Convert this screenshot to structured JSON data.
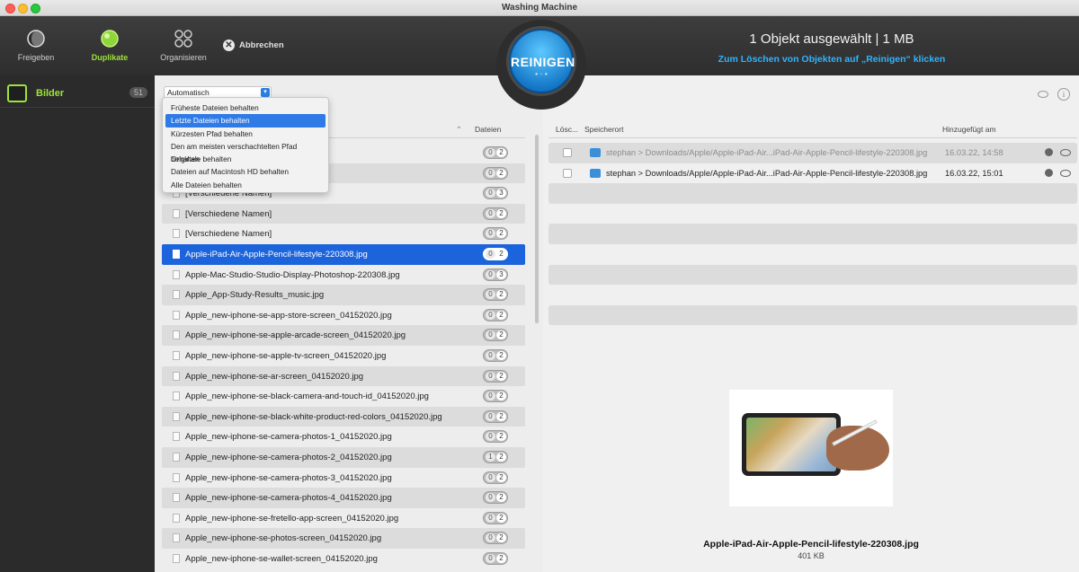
{
  "window": {
    "title": "Washing Machine"
  },
  "toolbar": {
    "tools": [
      {
        "label": "Freigeben",
        "icon": "moon-icon"
      },
      {
        "label": "Duplikate",
        "icon": "bubble-icon"
      },
      {
        "label": "Organisieren",
        "icon": "grid-circles-icon"
      }
    ],
    "cancel_label": "Abbrechen",
    "clean_label": "REINIGEN",
    "summary_title": "1 Objekt ausgewählt | 1 MB",
    "summary_hint": "Zum Löschen von Objekten auf „Reinigen“ klicken"
  },
  "sidebar": {
    "items": [
      {
        "label": "Bilder",
        "count": "51",
        "icon": "pictures-folder-icon"
      }
    ]
  },
  "left": {
    "dropdown_value": "Automatisch",
    "menu": [
      "Früheste Dateien behalten",
      "Letzte Dateien behalten",
      "Kürzesten Pfad behalten",
      "Den am meisten verschachtelten Pfad behalten",
      "Originale behalten",
      "Dateien auf Macintosh HD behalten",
      "Alle Dateien behalten"
    ],
    "menu_highlighted_index": 1,
    "column_files": "Dateien",
    "rows": [
      {
        "name": "[Verschiedene Namen]",
        "a": "0",
        "b": "2"
      },
      {
        "name": "[Verschiedene Namen]",
        "a": "0",
        "b": "2"
      },
      {
        "name": "[Verschiedene Namen]",
        "a": "0",
        "b": "3"
      },
      {
        "name": "[Verschiedene Namen]",
        "a": "0",
        "b": "2"
      },
      {
        "name": "[Verschiedene Namen]",
        "a": "0",
        "b": "2"
      },
      {
        "name": "Apple-iPad-Air-Apple-Pencil-lifestyle-220308.jpg",
        "a": "0",
        "b": "2"
      },
      {
        "name": "Apple-Mac-Studio-Studio-Display-Photoshop-220308.jpg",
        "a": "0",
        "b": "3"
      },
      {
        "name": "Apple_App-Study-Results_music.jpg",
        "a": "0",
        "b": "2"
      },
      {
        "name": "Apple_new-iphone-se-app-store-screen_04152020.jpg",
        "a": "0",
        "b": "2"
      },
      {
        "name": "Apple_new-iphone-se-apple-arcade-screen_04152020.jpg",
        "a": "0",
        "b": "2"
      },
      {
        "name": "Apple_new-iphone-se-apple-tv-screen_04152020.jpg",
        "a": "0",
        "b": "2"
      },
      {
        "name": "Apple_new-iphone-se-ar-screen_04152020.jpg",
        "a": "0",
        "b": "2"
      },
      {
        "name": "Apple_new-iphone-se-black-camera-and-touch-id_04152020.jpg",
        "a": "0",
        "b": "2"
      },
      {
        "name": "Apple_new-iphone-se-black-white-product-red-colors_04152020.jpg",
        "a": "0",
        "b": "2"
      },
      {
        "name": "Apple_new-iphone-se-camera-photos-1_04152020.jpg",
        "a": "0",
        "b": "2"
      },
      {
        "name": "Apple_new-iphone-se-camera-photos-2_04152020.jpg",
        "a": "1",
        "b": "2"
      },
      {
        "name": "Apple_new-iphone-se-camera-photos-3_04152020.jpg",
        "a": "0",
        "b": "2"
      },
      {
        "name": "Apple_new-iphone-se-camera-photos-4_04152020.jpg",
        "a": "0",
        "b": "2"
      },
      {
        "name": "Apple_new-iphone-se-fretello-app-screen_04152020.jpg",
        "a": "0",
        "b": "2"
      },
      {
        "name": "Apple_new-iphone-se-photos-screen_04152020.jpg",
        "a": "0",
        "b": "2"
      },
      {
        "name": "Apple_new-iphone-se-wallet-screen_04152020.jpg",
        "a": "0",
        "b": "2"
      }
    ],
    "selected_index": 5
  },
  "right": {
    "columns": {
      "delete": "Lösc...",
      "location": "Speicherort",
      "added": "Hinzugefügt am"
    },
    "rows": [
      {
        "path": "stephan > Downloads/Apple/Apple-iPad-Air...iPad-Air-Apple-Pencil-lifestyle-220308.jpg",
        "date": "16.03.22, 14:58"
      },
      {
        "path": "stephan > Downloads/Apple/Apple-iPad-Air...iPad-Air-Apple-Pencil-lifestyle-220308.jpg",
        "date": "16.03.22, 15:01"
      }
    ],
    "preview_name": "Apple-iPad-Air-Apple-Pencil-lifestyle-220308.jpg",
    "preview_size": "401 KB"
  },
  "colors": {
    "accent_green": "#9ee33a",
    "select_blue": "#1c64dc",
    "hint_blue": "#2fb4ff"
  }
}
